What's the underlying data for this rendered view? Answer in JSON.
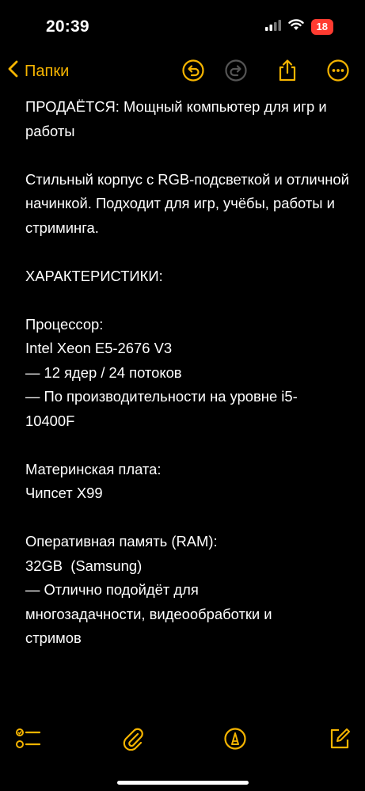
{
  "status": {
    "time": "20:39",
    "battery": "18"
  },
  "nav": {
    "back_label": "Папки"
  },
  "note": {
    "title": "ПРОДАЁТСЯ: Мощный компьютер для игр и работы",
    "intro": "Стильный корпус с RGB-подсветкой и отличной начинкой. Подходит для игр, учёбы, работы и стриминга.",
    "specs_header": "ХАРАКТЕРИСТИКИ:",
    "cpu": {
      "label": "Процессор:",
      "model": "Intel Xeon E5-2676 V3",
      "cores": "— 12 ядер / 24 потоков",
      "perf": "— По производительности на уровне i5-10400F"
    },
    "motherboard": {
      "label": "Материнская плата:",
      "chipset": "Чипсет X99"
    },
    "ram": {
      "label": "Оперативная память (RAM):",
      "size": "32GB  (Samsung)",
      "note": "— Отлично подойдёт для многозадачности, видеообработки и стримов"
    }
  },
  "colors": {
    "accent": "#f5b400",
    "background": "#000000",
    "battery": "#ff3b30"
  },
  "icons": [
    "chevron-left-icon",
    "undo-icon",
    "redo-icon",
    "share-icon",
    "more-icon",
    "checklist-icon",
    "attachment-icon",
    "markup-icon",
    "compose-icon"
  ]
}
